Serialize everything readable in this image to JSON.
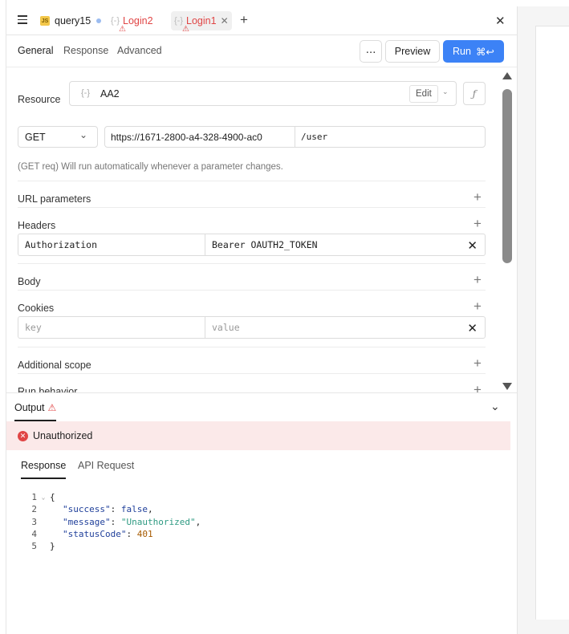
{
  "tabs": [
    {
      "label": "query15",
      "badge": "JS",
      "unsaved": true
    },
    {
      "label": "Login2",
      "warning": true
    },
    {
      "label": "Login1",
      "warning": true,
      "active": true
    }
  ],
  "subtabs": {
    "general": "General",
    "response": "Response",
    "advanced": "Advanced"
  },
  "actions": {
    "more": "⋯",
    "preview": "Preview",
    "run": "Run",
    "run_shortcut": "⌘↩"
  },
  "resource": {
    "label": "Resource",
    "value": "AA2",
    "edit": "Edit"
  },
  "request": {
    "method": "GET",
    "base_url": "https://1671-2800-a4-328-4900-ac0",
    "path": "/user",
    "hint": "(GET req) Will run automatically whenever a parameter changes."
  },
  "sections": {
    "url_params": "URL parameters",
    "headers": "Headers",
    "body": "Body",
    "cookies": "Cookies",
    "additional_scope": "Additional scope",
    "run_behavior": "Run behavior"
  },
  "headers_rows": [
    {
      "key": "Authorization",
      "value": "Bearer OAUTH2_TOKEN"
    }
  ],
  "cookies_row": {
    "key_placeholder": "key",
    "value_placeholder": "value"
  },
  "output": {
    "title": "Output",
    "error": "Unauthorized",
    "tabs": {
      "response": "Response",
      "api_request": "API Request"
    }
  },
  "code_lines": [
    {
      "n": "1",
      "tokens": [
        {
          "t": "{",
          "c": "p"
        }
      ]
    },
    {
      "n": "2",
      "tokens": [
        {
          "t": "\"success\"",
          "c": "key"
        },
        {
          "t": ": ",
          "c": "p"
        },
        {
          "t": "false",
          "c": "bool"
        },
        {
          "t": ",",
          "c": "p"
        }
      ]
    },
    {
      "n": "3",
      "tokens": [
        {
          "t": "\"message\"",
          "c": "key"
        },
        {
          "t": ": ",
          "c": "p"
        },
        {
          "t": "\"Unauthorized\"",
          "c": "str"
        },
        {
          "t": ",",
          "c": "p"
        }
      ]
    },
    {
      "n": "4",
      "tokens": [
        {
          "t": "\"statusCode\"",
          "c": "key"
        },
        {
          "t": ": ",
          "c": "p"
        },
        {
          "t": "401",
          "c": "num"
        }
      ]
    },
    {
      "n": "5",
      "tokens": [
        {
          "t": "}",
          "c": "p"
        }
      ]
    }
  ],
  "colors": {
    "accent": "#3c82f6",
    "error": "#e04545",
    "error_bg": "#fbe9e9"
  }
}
